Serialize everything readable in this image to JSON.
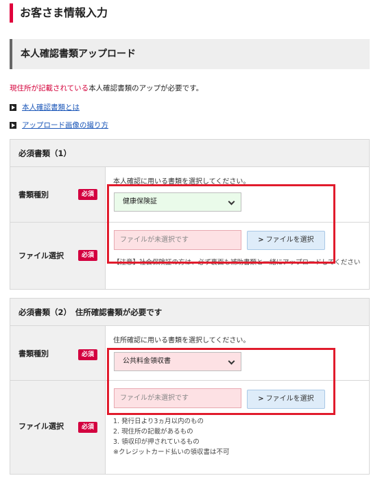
{
  "page_title": "お客さま情報入力",
  "section_title": "本人確認書類アップロード",
  "notice": {
    "red_part": "現住所が記載されている",
    "black_part": "本人確認書類のアップが必要です。"
  },
  "links": [
    {
      "label": "本人確認書類とは"
    },
    {
      "label": "アップロード画像の撮り方"
    }
  ],
  "required_badge": "必須",
  "cards": [
    {
      "header": "必須書類（1）",
      "doc_type_label": "書類種別",
      "hint": "本人確認に用いる書類を選択してください。",
      "selected": "健康保険証",
      "file_label": "ファイル選択",
      "file_placeholder": "ファイルが未選択です",
      "file_button": "ファイルを選択",
      "note": "【注意】社会保険証の方は、必ず裏面も補助書類と一緒にアップロードしてください"
    },
    {
      "header": "必須書類（2）　住所確認書類が必要です",
      "doc_type_label": "書類種別",
      "hint": "住所確認に用いる書類を選択してください。",
      "selected": "公共料金領収書",
      "file_label": "ファイル選択",
      "file_placeholder": "ファイルが未選択です",
      "file_button": "ファイルを選択",
      "requirements": [
        "1. 発行日より3ヵ月以内のもの",
        "2. 現住所の記載があるもの",
        "3. 領収印が押されているもの",
        "※クレジットカード払いの領収書は不可"
      ]
    }
  ],
  "colors": {
    "accent_red": "#e0003c",
    "required_badge": "#d3003f",
    "highlight_border": "#e11b2c",
    "link": "#1a56b8",
    "select_green": "#eafbea",
    "select_pink": "#fde1e4",
    "file_button_bg": "#deecf9"
  }
}
